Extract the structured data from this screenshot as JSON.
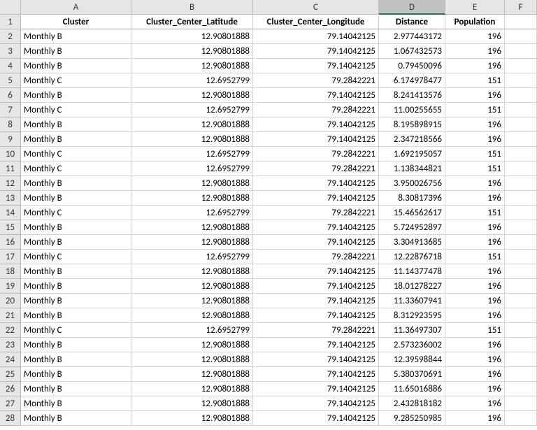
{
  "columns": {
    "letters": [
      "A",
      "B",
      "C",
      "D",
      "E",
      "F"
    ],
    "headers": [
      "Cluster",
      "Cluster_Center_Latitude",
      "Cluster_Center_Longitude",
      "Distance",
      "Population",
      ""
    ]
  },
  "selected_column": "D",
  "rows": [
    {
      "r": 2,
      "cluster": "Monthly B",
      "lat": "12.90801888",
      "lon": "79.14042125",
      "dist": "2.977443172",
      "pop": "196"
    },
    {
      "r": 3,
      "cluster": "Monthly B",
      "lat": "12.90801888",
      "lon": "79.14042125",
      "dist": "1.067432573",
      "pop": "196"
    },
    {
      "r": 4,
      "cluster": "Monthly B",
      "lat": "12.90801888",
      "lon": "79.14042125",
      "dist": "0.79450096",
      "pop": "196"
    },
    {
      "r": 5,
      "cluster": "Monthly C",
      "lat": "12.6952799",
      "lon": "79.2842221",
      "dist": "6.174978477",
      "pop": "151"
    },
    {
      "r": 6,
      "cluster": "Monthly B",
      "lat": "12.90801888",
      "lon": "79.14042125",
      "dist": "8.241413576",
      "pop": "196"
    },
    {
      "r": 7,
      "cluster": "Monthly C",
      "lat": "12.6952799",
      "lon": "79.2842221",
      "dist": "11.00255655",
      "pop": "151"
    },
    {
      "r": 8,
      "cluster": "Monthly B",
      "lat": "12.90801888",
      "lon": "79.14042125",
      "dist": "8.195898915",
      "pop": "196"
    },
    {
      "r": 9,
      "cluster": "Monthly B",
      "lat": "12.90801888",
      "lon": "79.14042125",
      "dist": "2.347218566",
      "pop": "196"
    },
    {
      "r": 10,
      "cluster": "Monthly C",
      "lat": "12.6952799",
      "lon": "79.2842221",
      "dist": "1.692195057",
      "pop": "151"
    },
    {
      "r": 11,
      "cluster": "Monthly C",
      "lat": "12.6952799",
      "lon": "79.2842221",
      "dist": "1.138344821",
      "pop": "151"
    },
    {
      "r": 12,
      "cluster": "Monthly B",
      "lat": "12.90801888",
      "lon": "79.14042125",
      "dist": "3.950026756",
      "pop": "196"
    },
    {
      "r": 13,
      "cluster": "Monthly B",
      "lat": "12.90801888",
      "lon": "79.14042125",
      "dist": "8.30817396",
      "pop": "196"
    },
    {
      "r": 14,
      "cluster": "Monthly C",
      "lat": "12.6952799",
      "lon": "79.2842221",
      "dist": "15.46562617",
      "pop": "151"
    },
    {
      "r": 15,
      "cluster": "Monthly B",
      "lat": "12.90801888",
      "lon": "79.14042125",
      "dist": "5.724952897",
      "pop": "196"
    },
    {
      "r": 16,
      "cluster": "Monthly B",
      "lat": "12.90801888",
      "lon": "79.14042125",
      "dist": "3.304913685",
      "pop": "196"
    },
    {
      "r": 17,
      "cluster": "Monthly C",
      "lat": "12.6952799",
      "lon": "79.2842221",
      "dist": "12.22876718",
      "pop": "151"
    },
    {
      "r": 18,
      "cluster": "Monthly B",
      "lat": "12.90801888",
      "lon": "79.14042125",
      "dist": "11.14377478",
      "pop": "196"
    },
    {
      "r": 19,
      "cluster": "Monthly B",
      "lat": "12.90801888",
      "lon": "79.14042125",
      "dist": "18.01278227",
      "pop": "196"
    },
    {
      "r": 20,
      "cluster": "Monthly B",
      "lat": "12.90801888",
      "lon": "79.14042125",
      "dist": "11.33607941",
      "pop": "196"
    },
    {
      "r": 21,
      "cluster": "Monthly B",
      "lat": "12.90801888",
      "lon": "79.14042125",
      "dist": "8.312923595",
      "pop": "196"
    },
    {
      "r": 22,
      "cluster": "Monthly C",
      "lat": "12.6952799",
      "lon": "79.2842221",
      "dist": "11.36497307",
      "pop": "151"
    },
    {
      "r": 23,
      "cluster": "Monthly B",
      "lat": "12.90801888",
      "lon": "79.14042125",
      "dist": "2.573236002",
      "pop": "196"
    },
    {
      "r": 24,
      "cluster": "Monthly B",
      "lat": "12.90801888",
      "lon": "79.14042125",
      "dist": "12.39598844",
      "pop": "196"
    },
    {
      "r": 25,
      "cluster": "Monthly B",
      "lat": "12.90801888",
      "lon": "79.14042125",
      "dist": "5.380370691",
      "pop": "196"
    },
    {
      "r": 26,
      "cluster": "Monthly B",
      "lat": "12.90801888",
      "lon": "79.14042125",
      "dist": "11.65016886",
      "pop": "196"
    },
    {
      "r": 27,
      "cluster": "Monthly B",
      "lat": "12.90801888",
      "lon": "79.14042125",
      "dist": "2.432818182",
      "pop": "196"
    },
    {
      "r": 28,
      "cluster": "Monthly B",
      "lat": "12.90801888",
      "lon": "79.14042125",
      "dist": "9.285250985",
      "pop": "196"
    }
  ]
}
